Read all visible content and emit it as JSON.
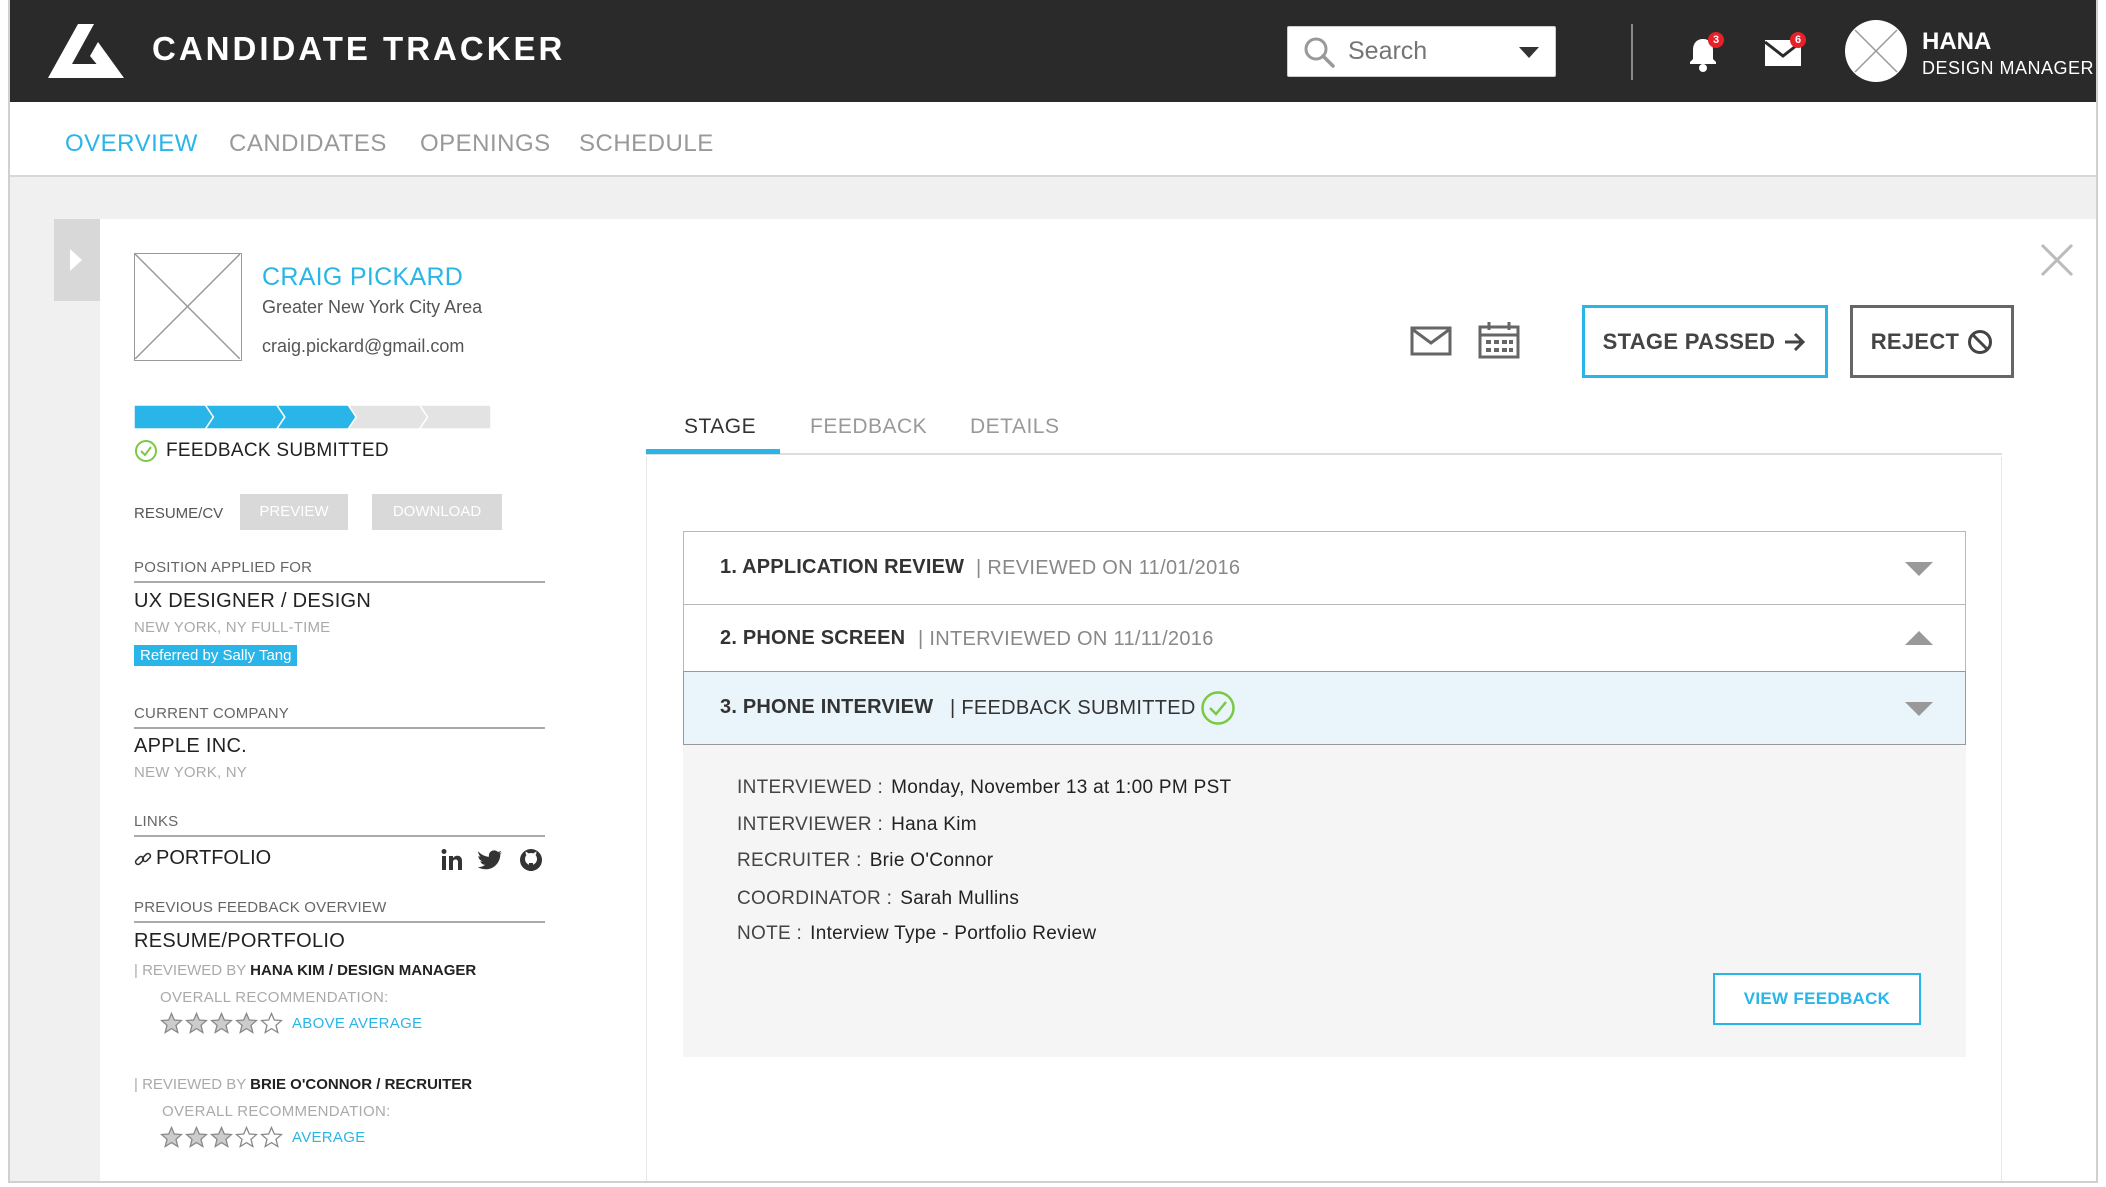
{
  "app": {
    "title": "CANDIDATE TRACKER"
  },
  "header": {
    "search_placeholder": "Search",
    "notifications_count": "3",
    "messages_count": "6",
    "user_name": "HANA",
    "user_role": "DESIGN MANAGER"
  },
  "nav": [
    "OVERVIEW",
    "CANDIDATES",
    "OPENINGS",
    "SCHEDULE"
  ],
  "candidate": {
    "name": "CRAIG PICKARD",
    "location": "Greater New York City Area",
    "email": "craig.pickard@gmail.com",
    "progress": {
      "steps_total": 5,
      "steps_complete": 3
    },
    "status": "FEEDBACK SUBMITTED",
    "resume_label": "RESUME/CV",
    "preview_label": "PREVIEW",
    "download_label": "DOWNLOAD",
    "position_label": "POSITION APPLIED FOR",
    "position": "UX DESIGNER / DESIGN",
    "position_meta": "NEW YORK, NY  FULL-TIME",
    "referral": "Referred by Sally Tang",
    "company_label": "CURRENT COMPANY",
    "company": "APPLE INC.",
    "company_location": "NEW YORK, NY",
    "links_label": "LINKS",
    "portfolio": "PORTFOLIO",
    "feedback_overview_label": "PREVIOUS FEEDBACK OVERVIEW",
    "feedback_overview_title": "RESUME/PORTFOLIO",
    "reviews": [
      {
        "prefix": "| REVIEWED BY",
        "reviewer": "HANA KIM / DESIGN MANAGER",
        "rec_label": "OVERALL RECOMMENDATION:",
        "stars": 4,
        "rating": "ABOVE AVERAGE"
      },
      {
        "prefix": "| REVIEWED BY",
        "reviewer": "BRIE O'CONNOR / RECRUITER",
        "rec_label": "OVERALL RECOMMENDATION:",
        "stars": 3,
        "rating": "AVERAGE"
      }
    ]
  },
  "actions": {
    "stage_passed": "STAGE PASSED",
    "reject": "REJECT"
  },
  "tabs": [
    "STAGE",
    "FEEDBACK",
    "DETAILS"
  ],
  "stages": [
    {
      "title": "1. APPLICATION REVIEW",
      "sub": "| REVIEWED ON 11/01/2016"
    },
    {
      "title": "2. PHONE SCREEN",
      "sub": "| INTERVIEWED ON 11/11/2016"
    },
    {
      "title": "3. PHONE INTERVIEW",
      "sub": "| FEEDBACK SUBMITTED"
    }
  ],
  "stage_detail": {
    "interviewed_label": "INTERVIEWED :",
    "interviewed": "Monday, November 13 at 1:00 PM PST",
    "interviewer_label": "INTERVIEWER :",
    "interviewer": "Hana Kim",
    "recruiter_label": "RECRUITER :",
    "recruiter": "Brie O'Connor",
    "coordinator_label": "COORDINATOR :",
    "coordinator": "Sarah Mullins",
    "note_label": "NOTE :",
    "note": "Interview Type - Portfolio Review",
    "view_feedback": "VIEW FEEDBACK"
  },
  "colors": {
    "accent": "#29b5e8",
    "header_bg": "#2a2a2a",
    "success": "#7ac943",
    "badge": "#e8202a"
  }
}
